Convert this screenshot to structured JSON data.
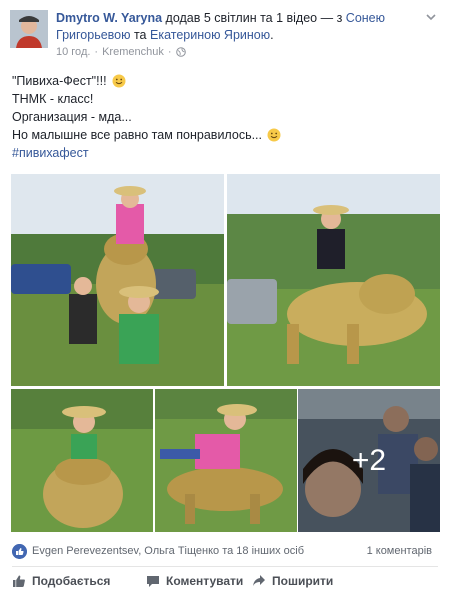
{
  "header": {
    "author": "Dmytro W. Yaryna",
    "action_text": "додав 5 світлин та 1 відео — з",
    "tagged_1": "Сонею Григорьевою",
    "conj": "та",
    "tagged_2": "Екатериною Яриною",
    "end": ".",
    "time": "10 год.",
    "sep": "·",
    "location": "Kremenchuk",
    "sep2": "·"
  },
  "post": {
    "line1": "\"Пивиха-Фест\"!!!",
    "line2": "ТНМК - класс!",
    "line3": "Организация - мда...",
    "line4": "Но малышне все равно там понравилось...",
    "hashtag": "#пивихафест"
  },
  "photos": {
    "more_count": "+2"
  },
  "reactions": {
    "names": "Evgen Perevezentsev, Ольга Тіщенко та 18 інших осіб",
    "comments": "1 коментарів"
  },
  "actions": {
    "like": "Подобається",
    "comment": "Коментувати",
    "share": "Поширити"
  },
  "colors": {
    "link": "#365899",
    "like_badge": "#4267b2"
  }
}
